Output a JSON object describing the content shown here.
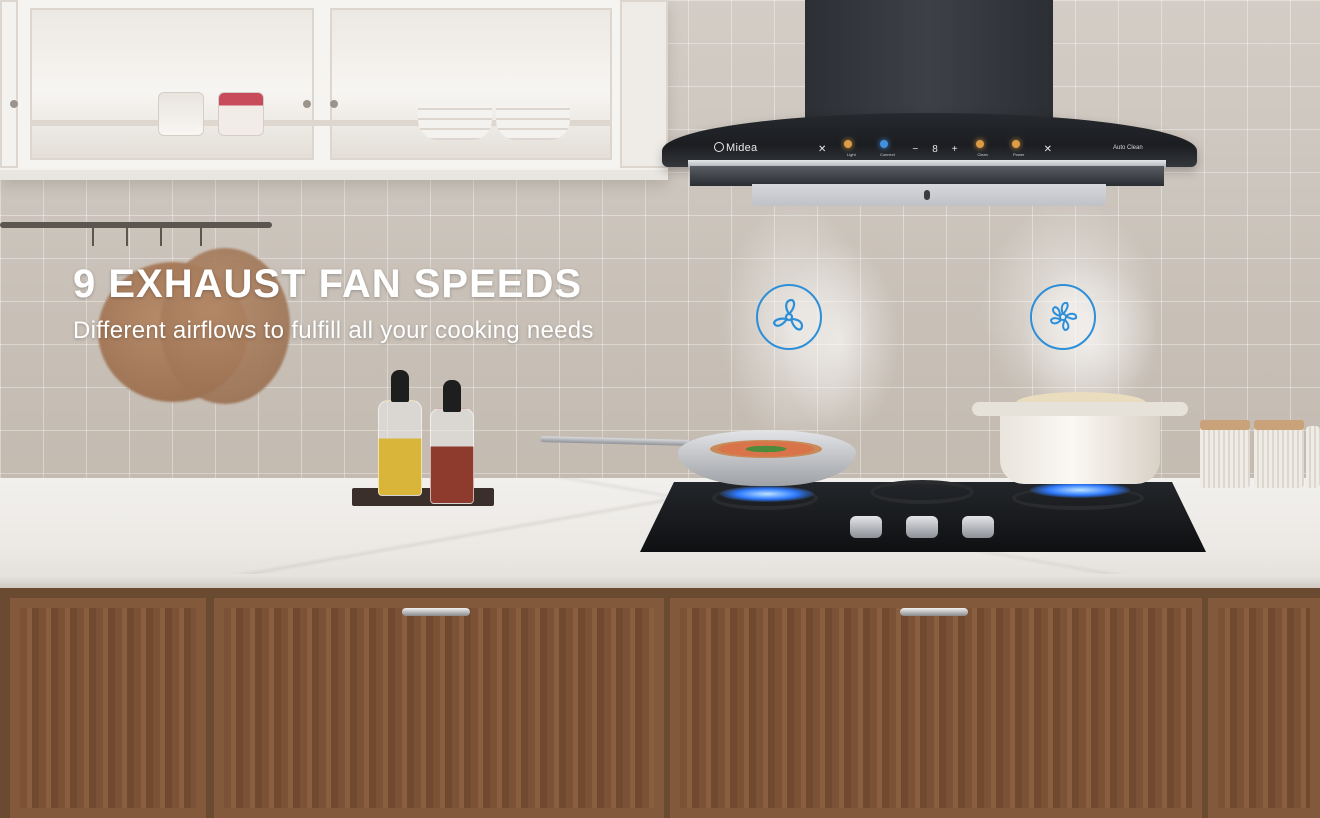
{
  "headline": {
    "title": "9 EXHAUST FAN SPEEDS",
    "subtitle": "Different airflows to fulfill all your cooking needs"
  },
  "hood": {
    "brand": "Midea",
    "auto_clean_label": "Auto Clean",
    "panel": [
      {
        "label": "Light",
        "icon": "light-icon",
        "color": "#ffb24a"
      },
      {
        "label": "Connect",
        "icon": "wifi-icon",
        "color": "#4aa6ff"
      },
      {
        "label": "−",
        "icon": "minus-icon"
      },
      {
        "label": "8",
        "icon": "speed-display"
      },
      {
        "label": "+",
        "icon": "plus-icon"
      },
      {
        "label": "Clean",
        "icon": "clean-icon",
        "color": "#ffb24a"
      },
      {
        "label": "Power",
        "icon": "power-icon",
        "color": "#ffb24a"
      }
    ]
  },
  "badges": [
    {
      "icon": "fan-icon-low-speed",
      "color": "#2d8fd8"
    },
    {
      "icon": "fan-icon-high-speed",
      "color": "#2d8fd8"
    }
  ],
  "colors": {
    "accent_blue": "#2d8fd8",
    "headline_text": "#ffffff",
    "cabinet_wood": "#82593b"
  }
}
